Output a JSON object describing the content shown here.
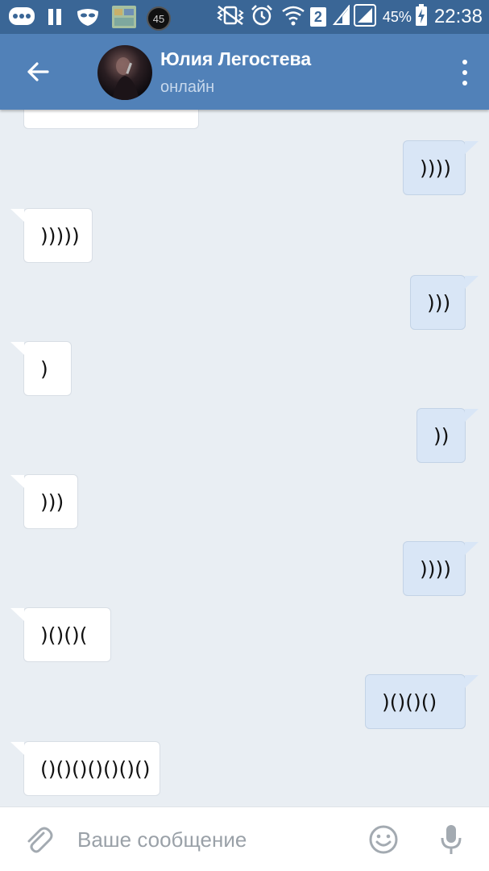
{
  "status_bar": {
    "notification_badge": "45",
    "sim_slot": "2",
    "battery_percent": "45%",
    "time": "22:38",
    "icons": [
      "messages-icon",
      "pause-icon",
      "mask-icon",
      "app-thumbnail-icon",
      "number-badge-icon",
      "vibrate-icon",
      "alarm-icon",
      "wifi-icon",
      "sim-2-icon",
      "signal-icon",
      "signal-icon",
      "battery-charging-icon"
    ]
  },
  "header": {
    "name": "Юлия Легостева",
    "status": "онлайн",
    "back_icon": "arrow-left-icon",
    "menu_icon": "more-vertical-icon"
  },
  "messages": [
    {
      "direction": "in",
      "text": ")))",
      "partial": true
    },
    {
      "direction": "out",
      "text": "))))"
    },
    {
      "direction": "in",
      "text": ")))))"
    },
    {
      "direction": "out",
      "text": ")))"
    },
    {
      "direction": "in",
      "text": ")"
    },
    {
      "direction": "out",
      "text": "))"
    },
    {
      "direction": "in",
      "text": ")))"
    },
    {
      "direction": "out",
      "text": "))))"
    },
    {
      "direction": "in",
      "text": ")()()("
    },
    {
      "direction": "out",
      "text": ")()()()"
    },
    {
      "direction": "in",
      "text": "()()()()()()()"
    }
  ],
  "input": {
    "placeholder": "Ваше сообщение",
    "value": "",
    "attach_icon": "paperclip-icon",
    "emoji_icon": "smiley-icon",
    "mic_icon": "microphone-icon"
  },
  "colors": {
    "status_bar": "#3a6696",
    "header": "#5181b8",
    "background": "#e9eef3",
    "bubble_in": "#ffffff",
    "bubble_out": "#d9e6f6"
  }
}
